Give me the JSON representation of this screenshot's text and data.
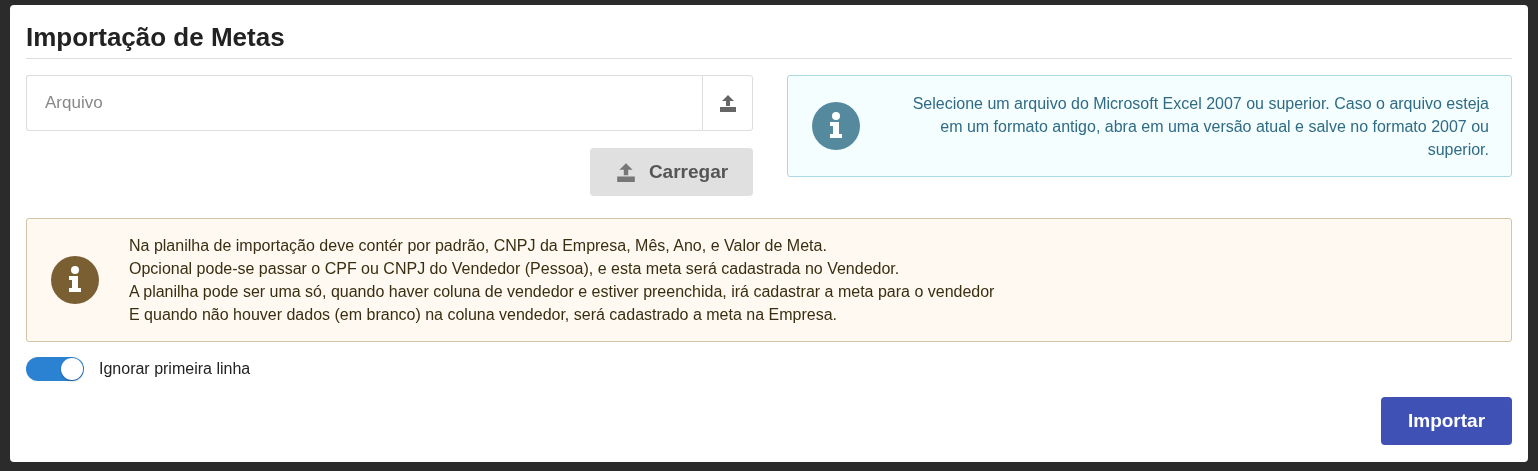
{
  "title": "Importação de Metas",
  "file_field": {
    "placeholder": "Arquivo"
  },
  "upload_button": {
    "label": "Carregar",
    "disabled": true
  },
  "info_box": {
    "text": "Selecione um arquivo do Microsoft Excel 2007 ou superior. Caso o arquivo esteja em um formato antigo, abra em uma versão atual e salve no formato 2007 ou superior."
  },
  "notice": {
    "lines": [
      "Na planilha de importação deve contér por padrão, CNPJ da Empresa, Mês, Ano, e Valor de Meta.",
      "Opcional pode-se passar o CPF ou CNPJ do Vendedor (Pessoa), e esta meta será cadastrada no Vendedor.",
      "A planilha pode ser uma só, quando haver coluna de vendedor e estiver preenchida, irá cadastrar a meta para o vendedor",
      "E quando não houver dados (em branco) na coluna vendedor, será cadastrado a meta na Empresa."
    ]
  },
  "toggle": {
    "label": "Ignorar primeira linha",
    "on": true
  },
  "import_button": {
    "label": "Importar"
  }
}
